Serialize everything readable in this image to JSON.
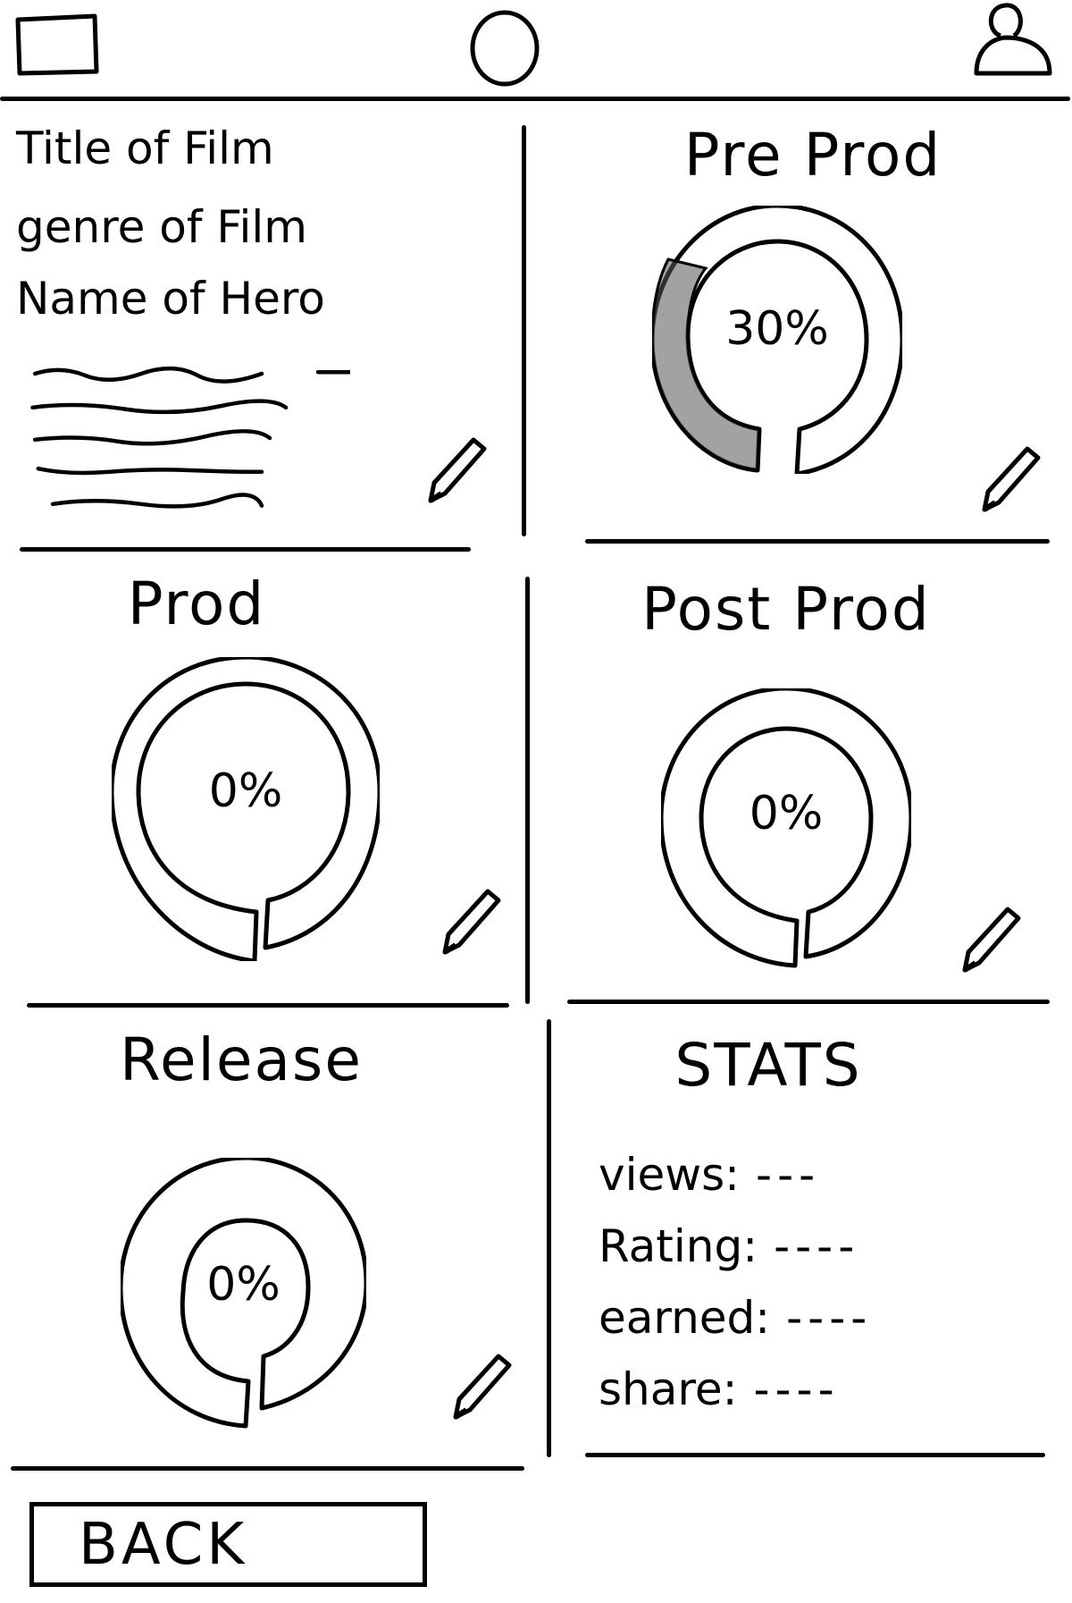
{
  "topbar": {
    "left_icon": "square-icon",
    "center_icon": "circle-icon",
    "right_icon": "user-icon"
  },
  "film_info": {
    "title": "Title of Film",
    "genre": "genre of Film",
    "hero": "Name of Hero"
  },
  "stages": [
    {
      "label": "Pre Prod",
      "percent_text": "30%",
      "progress": 0.3
    },
    {
      "label": "Prod",
      "percent_text": "0%",
      "progress": 0
    },
    {
      "label": "Post Prod",
      "percent_text": "0%",
      "progress": 0
    },
    {
      "label": "Release",
      "percent_text": "0%",
      "progress": 0
    }
  ],
  "stats": {
    "title": "STATS",
    "rows": [
      {
        "label": "views:",
        "value": "---"
      },
      {
        "label": "Rating:",
        "value": "----"
      },
      {
        "label": "earned:",
        "value": "----"
      },
      {
        "label": "share:",
        "value": "----"
      }
    ]
  },
  "footer": {
    "back_label": "BACK"
  },
  "icons": {
    "edit": "pencil-icon"
  }
}
